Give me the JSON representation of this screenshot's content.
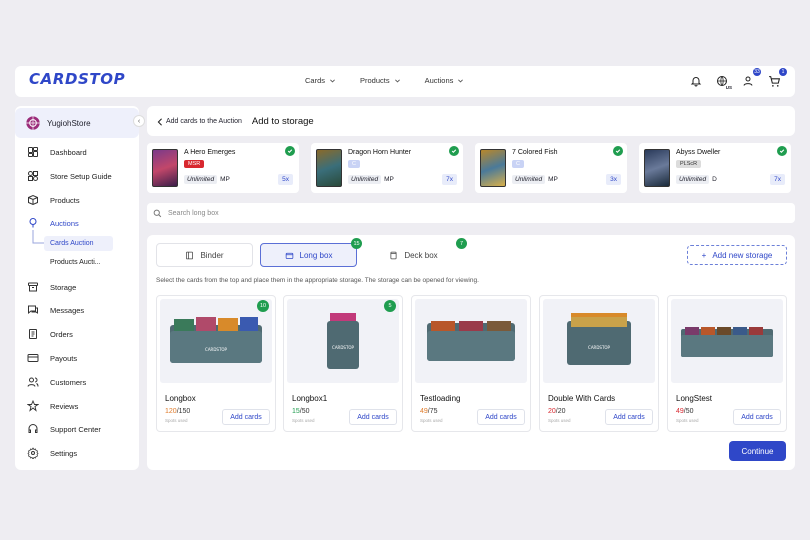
{
  "brand": {
    "logo": "CARDSTOP",
    "color": "#2f47c8"
  },
  "topnav": [
    {
      "label": "Cards"
    },
    {
      "label": "Products"
    },
    {
      "label": "Auctions"
    }
  ],
  "header_icons": {
    "globe_region": "US",
    "user_badge": "33",
    "cart_badge": "1"
  },
  "sidebar": {
    "store_name": "YugiohStore",
    "items": [
      {
        "label": "Dashboard",
        "icon": "dashboard-icon"
      },
      {
        "label": "Store Setup Guide",
        "icon": "setup-guide-icon"
      },
      {
        "label": "Products",
        "icon": "box-icon"
      },
      {
        "label": "Auctions",
        "icon": "auction-icon",
        "active": true
      },
      {
        "label": "Storage",
        "icon": "storage-icon"
      },
      {
        "label": "Messages",
        "icon": "messages-icon"
      },
      {
        "label": "Orders",
        "icon": "orders-icon"
      },
      {
        "label": "Payouts",
        "icon": "payouts-icon"
      },
      {
        "label": "Customers",
        "icon": "customers-icon"
      },
      {
        "label": "Reviews",
        "icon": "star-icon"
      },
      {
        "label": "Support Center",
        "icon": "support-icon"
      },
      {
        "label": "Settings",
        "icon": "gear-icon"
      }
    ],
    "auction_subitems": [
      "Cards Auction",
      "Products Aucti..."
    ]
  },
  "breadcrumb": {
    "back_label": "Add cards to the Auction",
    "title": "Add to storage"
  },
  "selected_cards": [
    {
      "name": "A Hero Emerges",
      "rarity": "MSR",
      "rarity_color": "#d8282f",
      "edition": "Unlimited",
      "condition": "MP",
      "qty": "5x"
    },
    {
      "name": "Dragon Horn Hunter",
      "rarity": "C",
      "rarity_color": "#c9d3f5",
      "edition": "Unlimited",
      "condition": "MP",
      "qty": "7x"
    },
    {
      "name": "7 Colored Fish",
      "rarity": "C",
      "rarity_color": "#c9d3f5",
      "edition": "Unlimited",
      "condition": "MP",
      "qty": "3x"
    },
    {
      "name": "Abyss Dweller",
      "rarity": "PLScR",
      "rarity_color": "#dcdcdc",
      "edition": "Unlimited",
      "condition": "D",
      "qty": "7x"
    }
  ],
  "search": {
    "placeholder": "Search long box"
  },
  "tabs": [
    {
      "label": "Binder",
      "count": ""
    },
    {
      "label": "Long box",
      "count": "15",
      "active": true
    },
    {
      "label": "Deck box",
      "count": "7"
    }
  ],
  "add_storage_label": "Add new storage",
  "hint": "Select the cards from the top and place them in the appropriate storage. The storage can be opened for viewing.",
  "storages": [
    {
      "name": "Longbox",
      "used": "120",
      "capacity": "150",
      "used_color": "#e07b2a",
      "sub": "Spots used",
      "badge": "10"
    },
    {
      "name": "Longbox1",
      "used": "15",
      "capacity": "50",
      "used_color": "#1f9d4f",
      "sub": "Spots used",
      "badge": "5"
    },
    {
      "name": "Testloading",
      "used": "49",
      "capacity": "75",
      "used_color": "#e07b2a",
      "sub": "Spots used",
      "badge": ""
    },
    {
      "name": "Double With Cards",
      "used": "20",
      "capacity": "20",
      "used_color": "#d8282f",
      "sub": "Spots used",
      "badge": ""
    },
    {
      "name": "LongStest",
      "used": "49",
      "capacity": "50",
      "used_color": "#d8282f",
      "sub": "Spots used",
      "badge": ""
    }
  ],
  "add_cards_label": "Add cards",
  "continue_label": "Continue"
}
